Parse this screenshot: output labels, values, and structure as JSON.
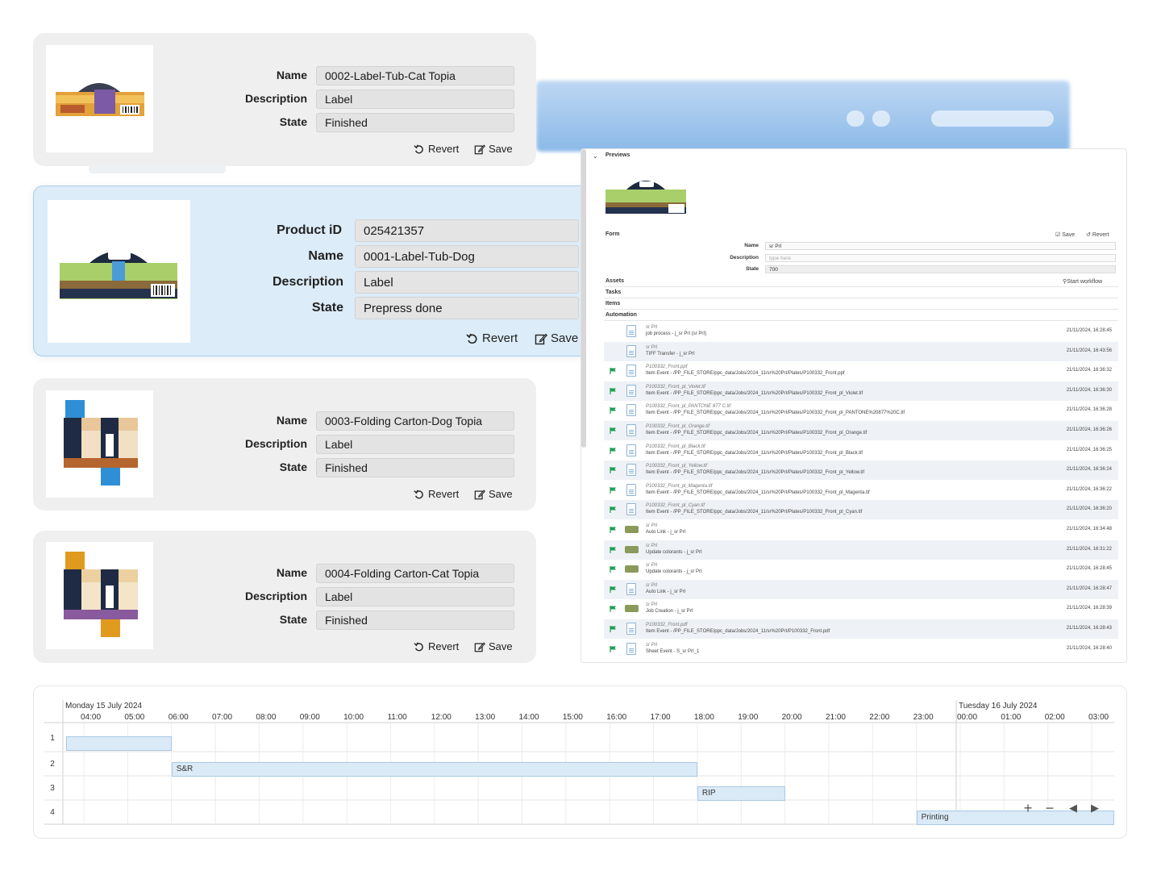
{
  "cards": [
    {
      "name_label": "Name",
      "name": "0002-Label-Tub-Cat Topia",
      "desc_label": "Description",
      "desc": "Label",
      "state_label": "State",
      "state": "Finished",
      "revert": "Revert",
      "save": "Save"
    },
    {
      "pid_label": "Product  iD",
      "pid": "025421357",
      "name_label": "Name",
      "name": "0001-Label-Tub-Dog",
      "desc_label": "Description",
      "desc": "Label",
      "state_label": "State",
      "state": "Prepress done",
      "revert": "Revert",
      "save": "Save"
    },
    {
      "name_label": "Name",
      "name": "0003-Folding Carton-Dog Topia",
      "desc_label": "Description",
      "desc": "Label",
      "state_label": "State",
      "state": "Finished",
      "revert": "Revert",
      "save": "Save"
    },
    {
      "name_label": "Name",
      "name": "0004-Folding Carton-Cat Topia",
      "desc_label": "Description",
      "desc": "Label",
      "state_label": "State",
      "state": "Finished",
      "revert": "Revert",
      "save": "Save"
    }
  ],
  "panel": {
    "previews": "Previews",
    "form": "Form",
    "save": "Save",
    "revert": "Revert",
    "name_label": "Name",
    "name": "sr PrI",
    "desc_label": "Description",
    "desc_placeholder": "type here",
    "state_label": "State",
    "state": "700",
    "assets": "Assets",
    "start_workflow": "Start workflow",
    "tasks": "Tasks",
    "items": "Items",
    "automation": "Automation",
    "events": [
      {
        "t1": "sr PrI",
        "t2": "job process - j_sr PrI (sr PrI)",
        "ts": "21/11/2024, 16:28:45",
        "icon": "doc",
        "flag": false
      },
      {
        "t1": "sr PrI",
        "t2": "TIFF Transfer - j_sr PrI",
        "ts": "21/11/2024, 16:43:56",
        "icon": "doc",
        "flag": false
      },
      {
        "t1": "P100332_Front.ppf",
        "t2": "Item Event - /PP_FILE_STORE/ppc_data/Jobs/2024_11/sr%20PrI/Plates/P100332_Front.ppf",
        "ts": "21/11/2024, 16:36:32",
        "icon": "doc",
        "flag": true
      },
      {
        "t1": "P100332_Front_pl_Violet.tif",
        "t2": "Item Event - /PP_FILE_STORE/ppc_data/Jobs/2024_11/sr%20PrI/Plates/P100332_Front_pl_Violet.tif",
        "ts": "21/11/2024, 16:36:30",
        "icon": "doc",
        "flag": true
      },
      {
        "t1": "P100332_Front_pl_PANTONE 877 C.tif",
        "t2": "Item Event - /PP_FILE_STORE/ppc_data/Jobs/2024_11/sr%20PrI/Plates/P100332_Front_pl_PANTONE%20877%20C.tif",
        "ts": "21/11/2024, 16:36:28",
        "icon": "doc",
        "flag": true
      },
      {
        "t1": "P100332_Front_pl_Orange.tif",
        "t2": "Item Event - /PP_FILE_STORE/ppc_data/Jobs/2024_11/sr%20PrI/Plates/P100332_Front_pl_Orange.tif",
        "ts": "21/11/2024, 16:36:26",
        "icon": "doc",
        "flag": true
      },
      {
        "t1": "P100332_Front_pl_Black.tif",
        "t2": "Item Event - /PP_FILE_STORE/ppc_data/Jobs/2024_11/sr%20PrI/Plates/P100332_Front_pl_Black.tif",
        "ts": "21/11/2024, 16:36:25",
        "icon": "doc",
        "flag": true
      },
      {
        "t1": "P100332_Front_pl_Yellow.tif",
        "t2": "Item Event - /PP_FILE_STORE/ppc_data/Jobs/2024_11/sr%20PrI/Plates/P100332_Front_pl_Yellow.tif",
        "ts": "21/11/2024, 16:36:24",
        "icon": "doc",
        "flag": true
      },
      {
        "t1": "P100332_Front_pl_Magenta.tif",
        "t2": "Item Event - /PP_FILE_STORE/ppc_data/Jobs/2024_11/sr%20PrI/Plates/P100332_Front_pl_Magenta.tif",
        "ts": "21/11/2024, 16:36:22",
        "icon": "doc",
        "flag": true
      },
      {
        "t1": "P100332_Front_pl_Cyan.tif",
        "t2": "Item Event - /PP_FILE_STORE/ppc_data/Jobs/2024_11/sr%20PrI/Plates/P100332_Front_pl_Cyan.tif",
        "ts": "21/11/2024, 16:36:20",
        "icon": "doc",
        "flag": true
      },
      {
        "t1": "sr PrI",
        "t2": "Auto Link - j_sr PrI",
        "ts": "21/11/2024, 16:34:48",
        "icon": "mini",
        "flag": true
      },
      {
        "t1": "sr PrI",
        "t2": "Update colorants - j_sr PrI",
        "ts": "21/11/2024, 16:31:22",
        "icon": "mini",
        "flag": true
      },
      {
        "t1": "sr PrI",
        "t2": "Update colorants - j_sr PrI",
        "ts": "21/11/2024, 16:28:45",
        "icon": "mini",
        "flag": true
      },
      {
        "t1": "sr PrI",
        "t2": "Auto Link - j_sr PrI",
        "ts": "21/11/2024, 16:28:47",
        "icon": "doc",
        "flag": true
      },
      {
        "t1": "sr PrI",
        "t2": "Job Creation - j_sr PrI",
        "ts": "21/11/2024, 16:28:39",
        "icon": "mini",
        "flag": true
      },
      {
        "t1": "P100332_Front.pdf",
        "t2": "Item Event - /PP_FILE_STORE/ppc_data/Jobs/2024_11/sr%20PrI/P100332_Front.pdf",
        "ts": "21/11/2024, 16:28:43",
        "icon": "doc",
        "flag": true
      },
      {
        "t1": "sr PrI",
        "t2": "Sheet Event - S_sr PrI_1",
        "ts": "21/11/2024, 16:28:40",
        "icon": "doc",
        "flag": true
      }
    ]
  },
  "timeline": {
    "day1": "Monday 15 July 2024",
    "day2": "Tuesday 16 July 2024",
    "hours": [
      "04:00",
      "05:00",
      "06:00",
      "07:00",
      "08:00",
      "09:00",
      "10:00",
      "11:00",
      "12:00",
      "13:00",
      "14:00",
      "15:00",
      "16:00",
      "17:00",
      "18:00",
      "19:00",
      "20:00",
      "21:00",
      "22:00",
      "23:00",
      "00:00",
      "01:00",
      "02:00",
      "03:00"
    ],
    "rows": [
      "1",
      "2",
      "3",
      "4"
    ],
    "bars": [
      {
        "row": 0,
        "start": 3.6,
        "end": 6.0,
        "label": ""
      },
      {
        "row": 1,
        "start": 6.0,
        "end": 18.0,
        "label": "S&R"
      },
      {
        "row": 2,
        "start": 18.0,
        "end": 20.0,
        "label": "RIP"
      },
      {
        "row": 3,
        "start": 23.0,
        "end": 27.8,
        "label": "Printing"
      }
    ]
  }
}
